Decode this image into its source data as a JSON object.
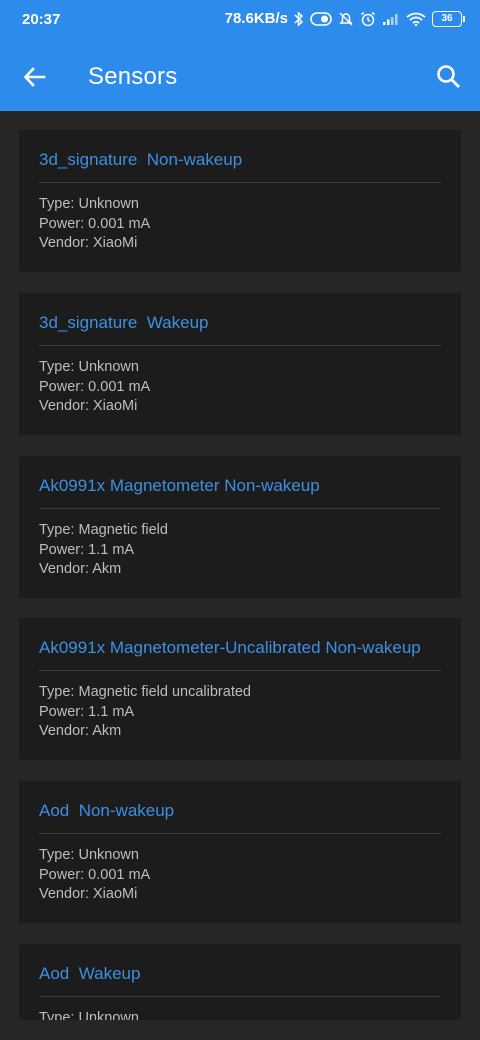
{
  "status_bar": {
    "time": "20:37",
    "network_speed": "78.6KB/s",
    "battery": "36",
    "icons": [
      "bluetooth-icon",
      "toggle-icon",
      "mute-icon",
      "alarm-icon",
      "signal-icon",
      "wifi-icon",
      "battery-icon"
    ]
  },
  "toolbar": {
    "title": "Sensors",
    "back_icon": "arrow-left-icon",
    "search_icon": "search-icon"
  },
  "colors": {
    "accent": "#2d8ceb",
    "title_text": "#3d8fe3",
    "card_bg": "#1c1c1c",
    "page_bg": "#262626"
  },
  "sensors": [
    {
      "name": "3d_signature  Non-wakeup",
      "type": "Type: Unknown",
      "power": "Power: 0.001 mA",
      "vendor": "Vendor: XiaoMi"
    },
    {
      "name": "3d_signature  Wakeup",
      "type": "Type: Unknown",
      "power": "Power: 0.001 mA",
      "vendor": "Vendor: XiaoMi"
    },
    {
      "name": "Ak0991x Magnetometer Non-wakeup",
      "type": "Type: Magnetic field",
      "power": "Power: 1.1 mA",
      "vendor": "Vendor: Akm"
    },
    {
      "name": "Ak0991x Magnetometer-Uncalibrated Non-wakeup",
      "type": "Type: Magnetic field uncalibrated",
      "power": "Power: 1.1 mA",
      "vendor": "Vendor: Akm"
    },
    {
      "name": "Aod  Non-wakeup",
      "type": "Type: Unknown",
      "power": "Power: 0.001 mA",
      "vendor": "Vendor: XiaoMi"
    },
    {
      "name": "Aod  Wakeup",
      "type": "Type: Unknown",
      "power": "",
      "vendor": ""
    }
  ]
}
